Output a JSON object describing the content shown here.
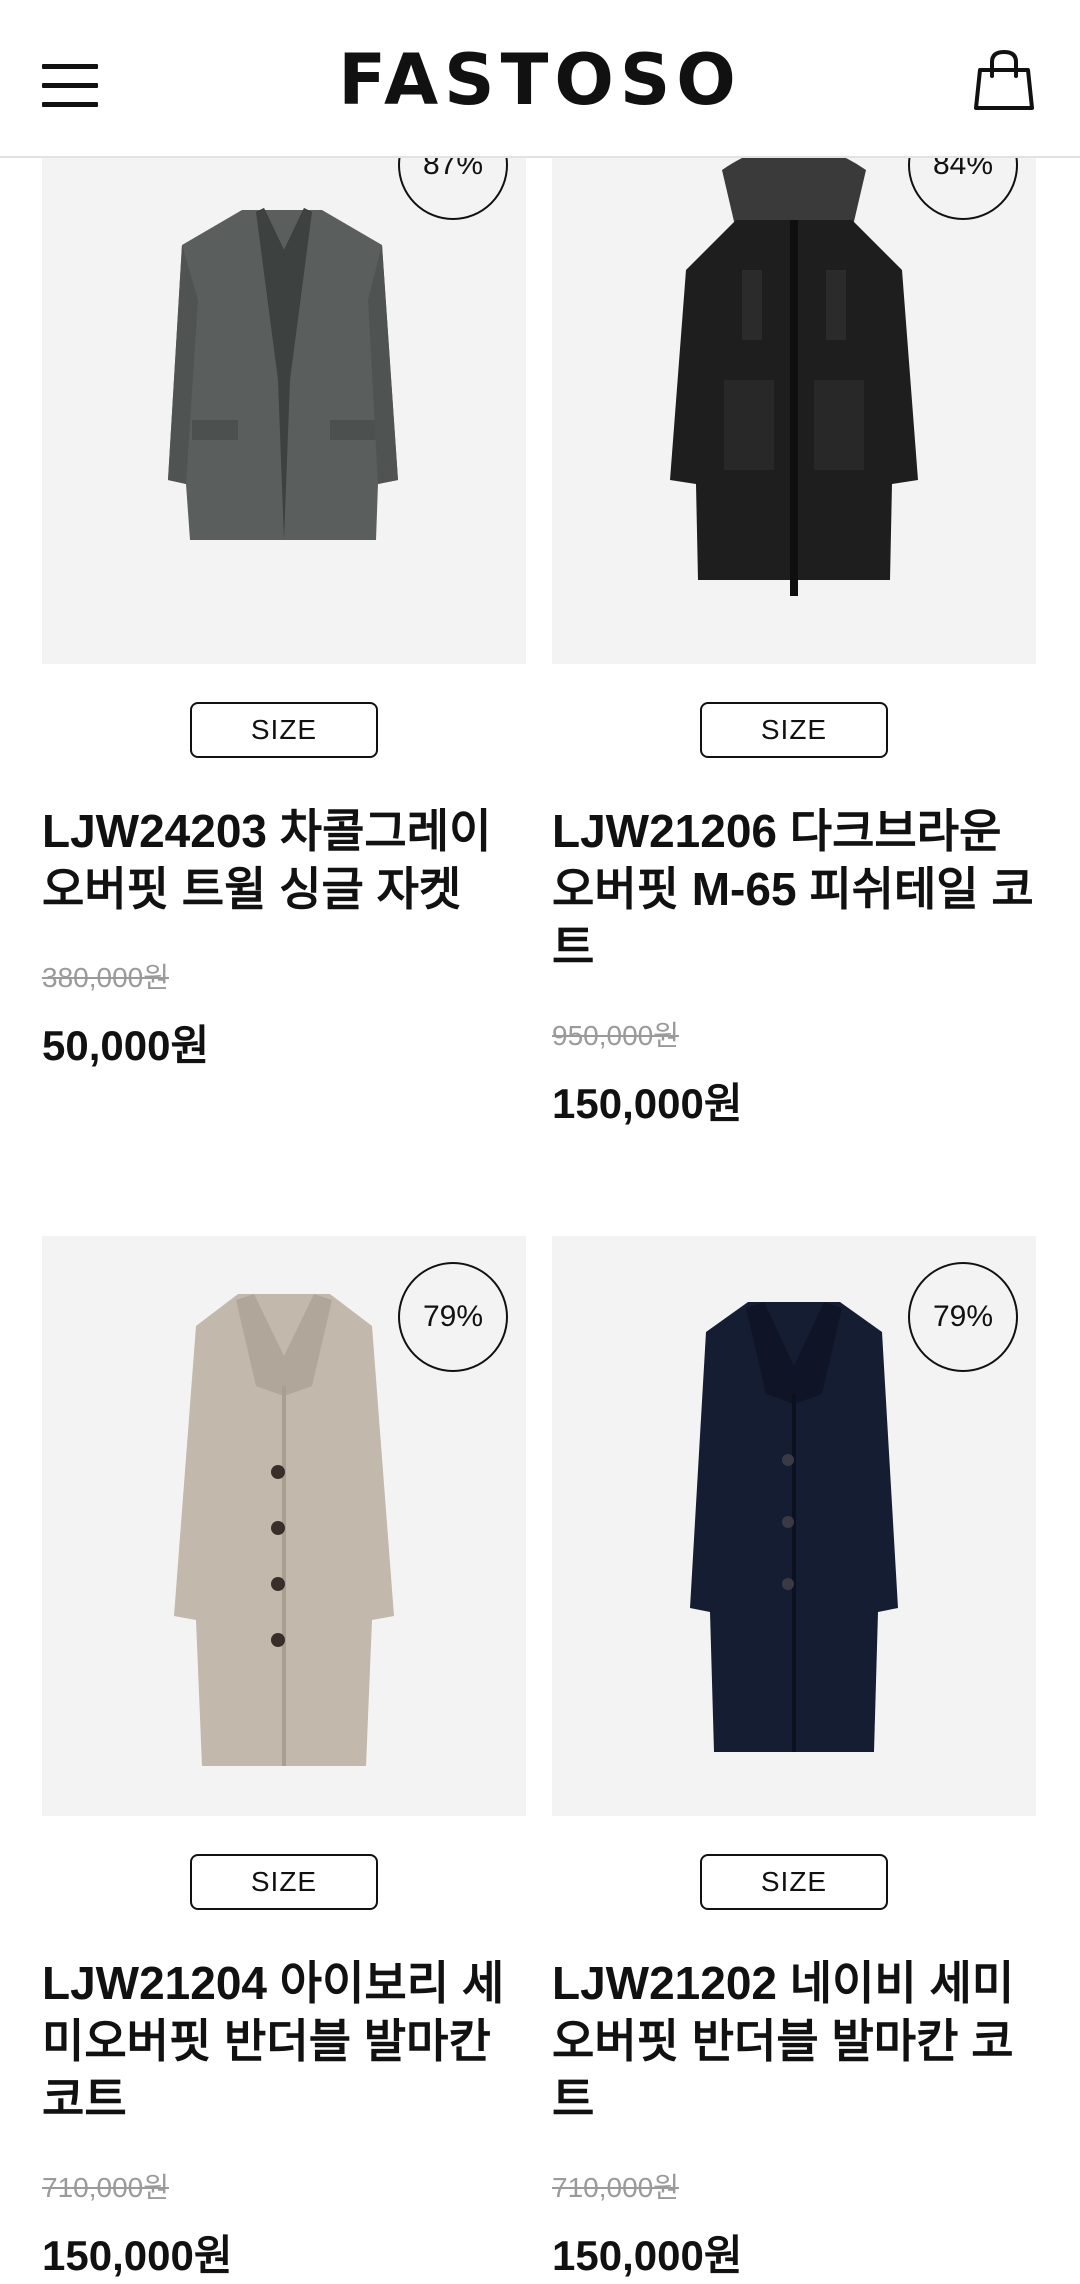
{
  "header": {
    "brand": "FASTOSO",
    "menu_icon": "hamburger-menu-icon",
    "cart_icon": "shopping-bag-icon"
  },
  "products": [
    {
      "discount": "87%",
      "size_label": "SIZE",
      "title": "LJW24203 차콜그레이 오버핏 트윌 싱글 자켓",
      "original_price": "380,000원",
      "sale_price": "50,000원",
      "image": "charcoal-gray-jacket"
    },
    {
      "discount": "84%",
      "size_label": "SIZE",
      "title": "LJW21206 다크브라운 오버핏 M-65 피쉬테일 코트",
      "original_price": "950,000원",
      "sale_price": "150,000원",
      "image": "dark-brown-parka"
    },
    {
      "discount": "79%",
      "size_label": "SIZE",
      "title": "LJW21204 아이보리 세미오버핏 반더블 발마칸 코트",
      "original_price": "710,000원",
      "sale_price": "150,000원",
      "image": "ivory-balmacaan-coat"
    },
    {
      "discount": "79%",
      "size_label": "SIZE",
      "title": "LJW21202 네이비 세미오버핏 반더블 발마칸 코트",
      "original_price": "710,000원",
      "sale_price": "150,000원",
      "image": "navy-balmacaan-coat"
    }
  ],
  "colors": {
    "text": "#111111",
    "image_bg": "#f3f3f3",
    "strike_price": "#9a9a9a",
    "charcoal": "#5a5f5d",
    "dark_coat": "#1e1e1e",
    "ivory": "#c2b8ab",
    "navy": "#151d33"
  }
}
